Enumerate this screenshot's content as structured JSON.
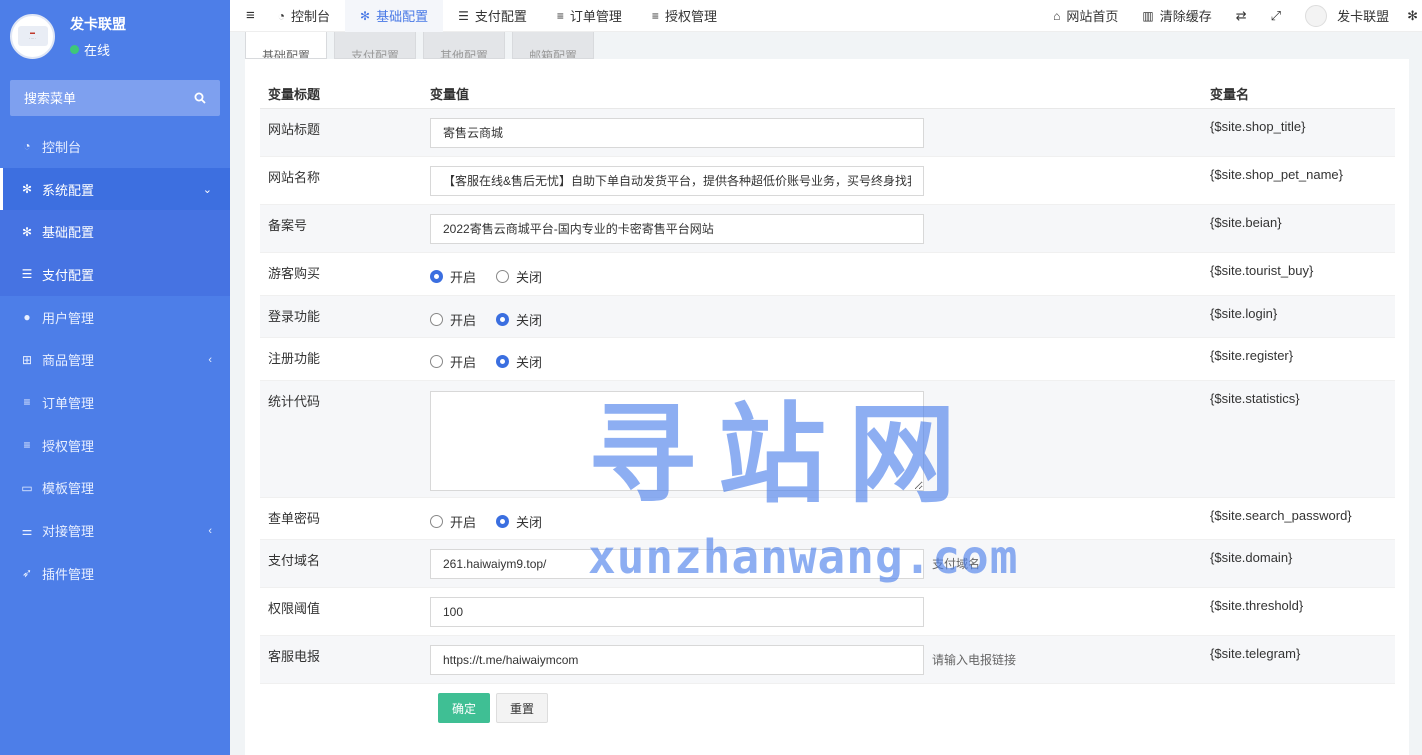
{
  "sidebar": {
    "user_name": "发卡联盟",
    "status": "在线",
    "search_placeholder": "搜索菜单",
    "items": [
      {
        "label": "控制台"
      },
      {
        "label": "系统配置"
      },
      {
        "label": "基础配置"
      },
      {
        "label": "支付配置"
      },
      {
        "label": "用户管理"
      },
      {
        "label": "商品管理"
      },
      {
        "label": "订单管理"
      },
      {
        "label": "授权管理"
      },
      {
        "label": "模板管理"
      },
      {
        "label": "对接管理"
      },
      {
        "label": "插件管理"
      }
    ]
  },
  "topbar": {
    "tabs": [
      {
        "label": "控制台"
      },
      {
        "label": "基础配置"
      },
      {
        "label": "支付配置"
      },
      {
        "label": "订单管理"
      },
      {
        "label": "授权管理"
      }
    ],
    "home": "网站首页",
    "clear_cache": "清除缓存",
    "user": "发卡联盟"
  },
  "config_tabs": [
    "基础配置",
    "支付配置",
    "其他配置",
    "邮箱配置"
  ],
  "table": {
    "headers": {
      "title": "变量标题",
      "value": "变量值",
      "name": "变量名"
    },
    "rows": [
      {
        "title": "网站标题",
        "value": "寄售云商城",
        "name": "{$site.shop_title}"
      },
      {
        "title": "网站名称",
        "value": "【客服在线&售后无忧】自助下单自动发货平台，提供各种超低价账号业务，买号终身找我",
        "name": "{$site.shop_pet_name}"
      },
      {
        "title": "备案号",
        "value": "2022寄售云商城平台-国内专业的卡密寄售平台网站",
        "name": "{$site.beian}"
      },
      {
        "title": "游客购买",
        "name": "{$site.tourist_buy}"
      },
      {
        "title": "登录功能",
        "name": "{$site.login}"
      },
      {
        "title": "注册功能",
        "name": "{$site.register}"
      },
      {
        "title": "统计代码",
        "value": "",
        "name": "{$site.statistics}"
      },
      {
        "title": "查单密码",
        "name": "{$site.search_password}"
      },
      {
        "title": "支付域名",
        "value": "261.haiwaiym9.top/",
        "hint": "支付域名",
        "name": "{$site.domain}"
      },
      {
        "title": "权限阈值",
        "value": "100",
        "name": "{$site.threshold}"
      },
      {
        "title": "客服电报",
        "value": "https://t.me/haiwaiymcom",
        "hint": "请输入电报链接",
        "name": "{$site.telegram}"
      }
    ],
    "radio_on": "开启",
    "radio_off": "关闭"
  },
  "buttons": {
    "ok": "确定",
    "reset": "重置"
  },
  "watermark": {
    "main": "寻站网",
    "sub": "xunzhanwang.com"
  }
}
